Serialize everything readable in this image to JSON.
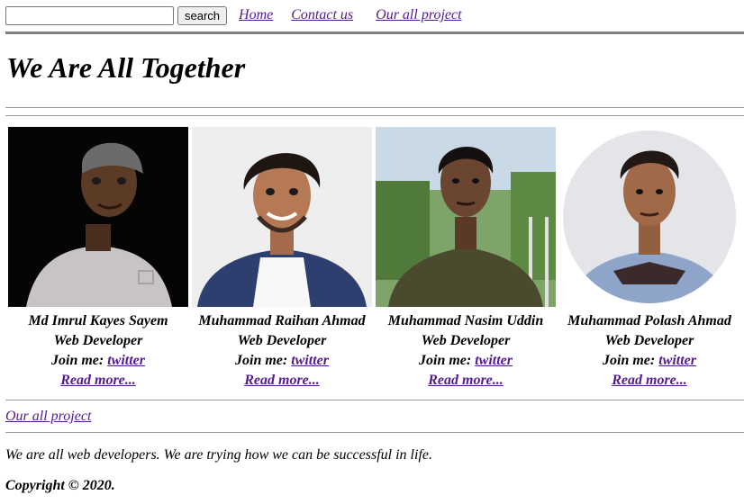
{
  "search": {
    "placeholder": "",
    "value": "",
    "button_label": "search"
  },
  "nav": [
    {
      "label": "Home"
    },
    {
      "label": "Contact us"
    },
    {
      "label": "Our all project"
    }
  ],
  "main": {
    "title": "We Are All Together",
    "team": [
      {
        "name": "Md Imrul Kayes Sayem",
        "role": "Web Developer",
        "join_label": "Join me:",
        "join_link": "twitter",
        "read_more": "Read more...",
        "photo_style": "dark-background"
      },
      {
        "name": "Muhammad Raihan Ahmad",
        "role": "Web Developer",
        "join_label": "Join me:",
        "join_link": "twitter",
        "read_more": "Read more...",
        "photo_style": "light-background"
      },
      {
        "name": "Muhammad Nasim Uddin",
        "role": "Web Developer",
        "join_label": "Join me:",
        "join_link": "twitter",
        "read_more": "Read more...",
        "photo_style": "outdoor-background"
      },
      {
        "name": "Muhammad Polash Ahmad",
        "role": "Web Developer",
        "join_label": "Join me:",
        "join_link": "twitter",
        "read_more": "Read more...",
        "photo_style": "circular-crop"
      }
    ]
  },
  "footer": {
    "link": "Our all project",
    "text": "We are all web developers. We are trying how we can be successful in life.",
    "copyright": "Copyright © 2020."
  },
  "colors": {
    "link": "#551a8b",
    "rule": "#808080"
  }
}
